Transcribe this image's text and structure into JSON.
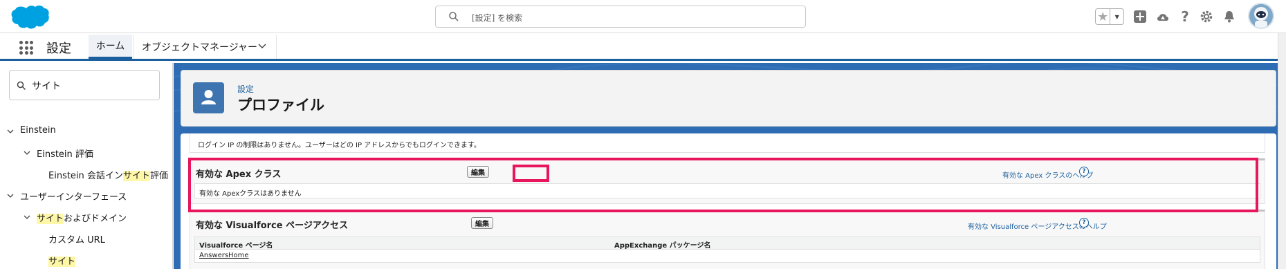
{
  "header": {
    "search_placeholder": "[設定] を検索",
    "colors": {
      "brand": "#00a1e0",
      "accent": "#1b5f9e",
      "highlight_box": "#e8175d"
    }
  },
  "nav": {
    "app_name": "設定",
    "tabs": [
      {
        "label": "ホーム"
      },
      {
        "label": "オブジェクトマネージャー"
      }
    ]
  },
  "sidebar": {
    "quick_find_value": "サイト",
    "items": [
      {
        "label": "Einstein"
      },
      {
        "label": "Einstein 評価"
      },
      {
        "label_pre": "Einstein 会話イン",
        "label_hl": "サイト",
        "label_post": "評価"
      },
      {
        "label": "ユーザーインターフェース"
      },
      {
        "label_hl": "サイト",
        "label_post": "およびドメイン"
      },
      {
        "label": "カスタム URL"
      },
      {
        "label_hl": "サイト"
      }
    ]
  },
  "page_header": {
    "breadcrumb": "設定",
    "title": "プロファイル"
  },
  "content": {
    "login_ip_note": "ログイン IP の制限はありません。ユーザーはどの IP アドレスからでもログインできます。",
    "apex_section": {
      "title": "有効な Apex クラス",
      "edit_label": "編集",
      "help_link": "有効な Apex クラスのヘルプ",
      "empty_text": "有効な Apexクラスはありません"
    },
    "vf_section": {
      "title": "有効な Visualforce ページアクセス",
      "edit_label": "編集",
      "help_link": "有効な Visualforce ページアクセスのヘルプ",
      "columns": [
        "Visualforce ページ名",
        "AppExchange パッケージ名"
      ],
      "rows": [
        "AnswersHome"
      ]
    }
  }
}
